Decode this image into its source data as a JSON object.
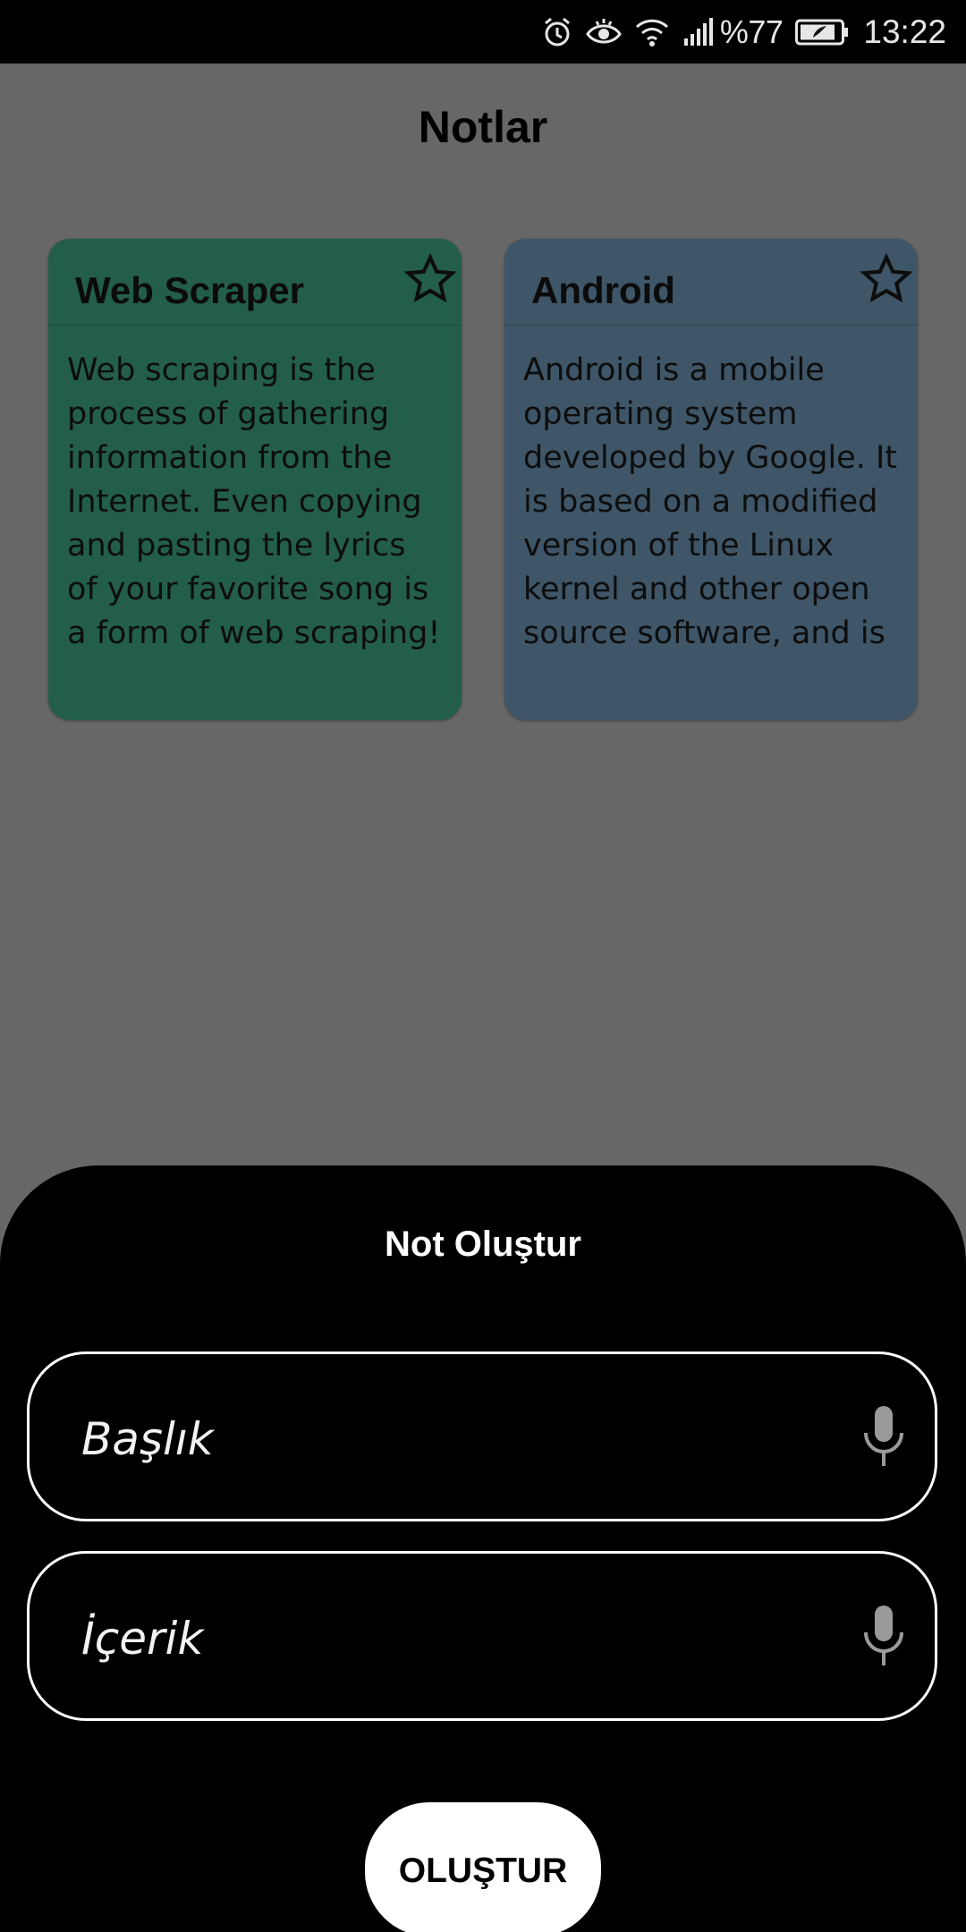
{
  "status_bar": {
    "battery_text": "%77",
    "time": "13:22",
    "icons": [
      "alarm-icon",
      "eye-icon",
      "wifi-icon",
      "signal-icon",
      "battery-icon"
    ]
  },
  "app": {
    "title": "Notlar",
    "notes": [
      {
        "title": "Web Scraper",
        "body": "Web scraping is the process of gathering information from the Internet. Even copying and pasting the lyrics of your favorite song is a form of web scraping! However, t…",
        "color": "#235e4a",
        "favorite": false
      },
      {
        "title": "Android",
        "body": "Android is a mobile operating system developed by Google. It is based on a modified version of the Linux kernel and other open source software, and is desi…",
        "color": "#3e5667",
        "favorite": false
      }
    ]
  },
  "sheet": {
    "title": "Not Oluştur",
    "title_field": {
      "placeholder": "Başlık",
      "icon": "mic-icon"
    },
    "content_field": {
      "placeholder": "İçerik",
      "icon": "mic-icon"
    },
    "create_label": "OLUŞTUR"
  }
}
